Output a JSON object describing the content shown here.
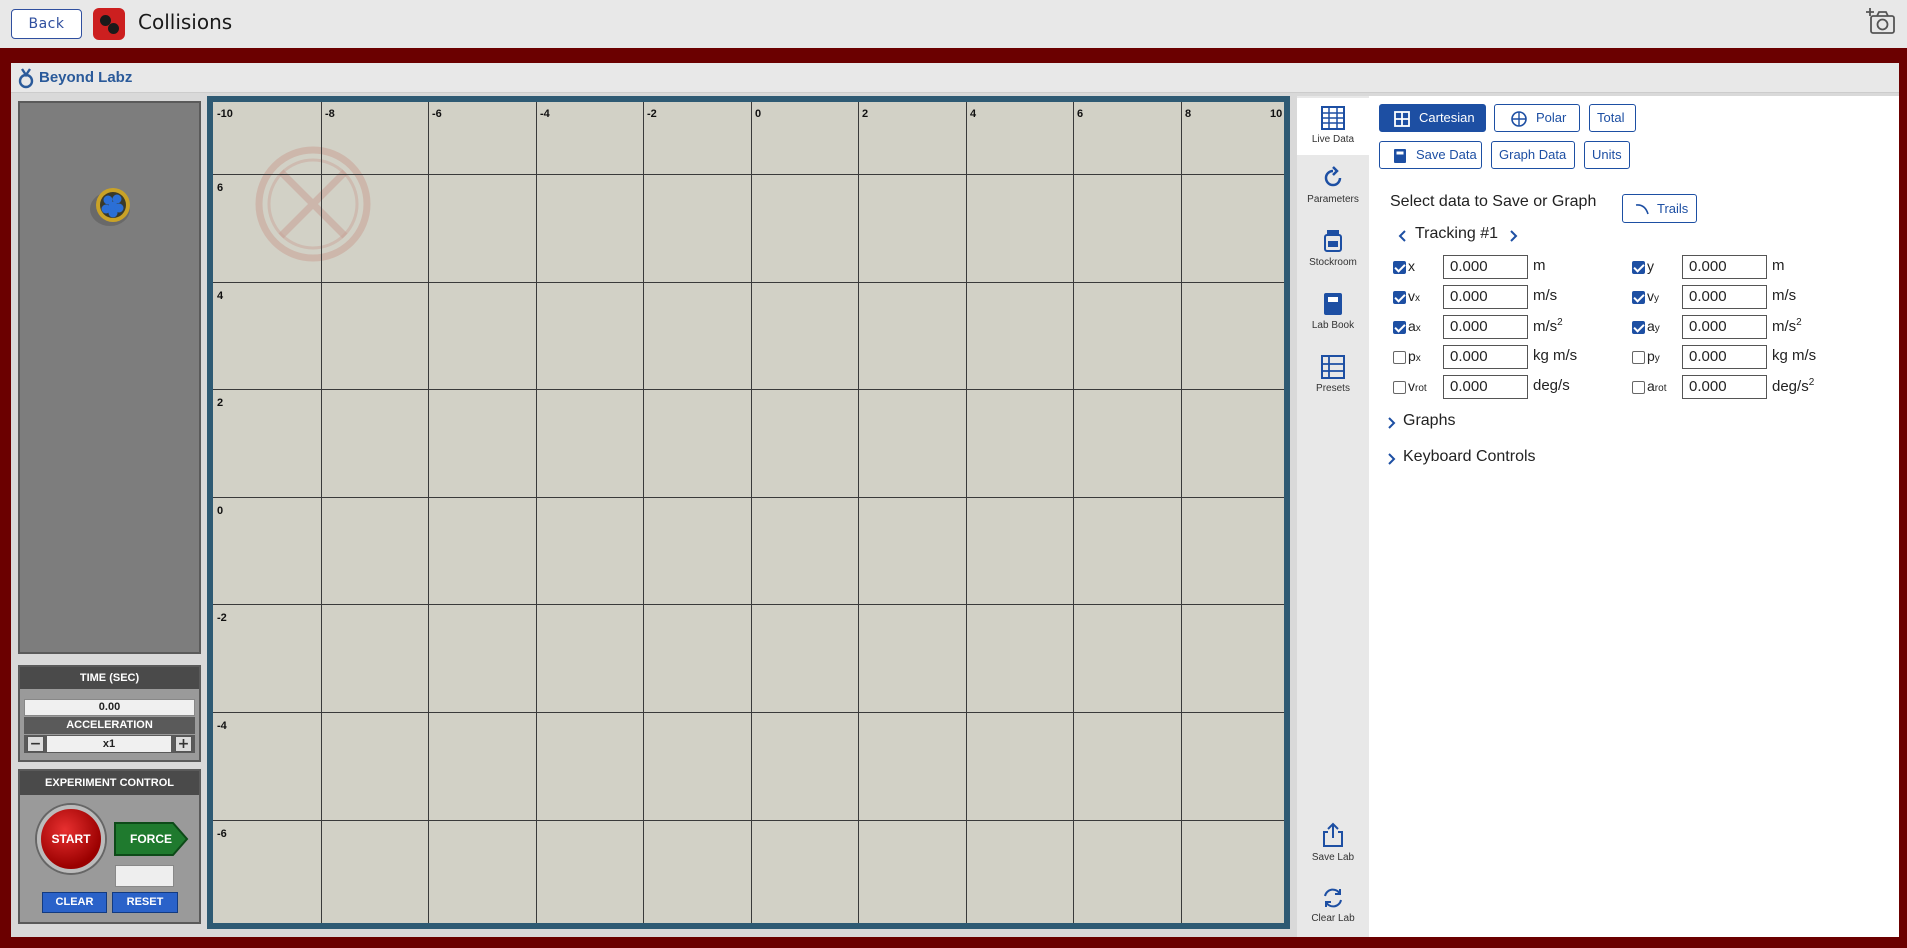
{
  "topbar": {
    "back_label": "Back",
    "title": "Collisions"
  },
  "brand": {
    "name": "Beyond Labz"
  },
  "time": {
    "header": "TIME (SEC)",
    "value": "0.00",
    "accel_label": "ACCELERATION",
    "accel_value": "x1",
    "minus": "−",
    "plus": "+"
  },
  "experiment": {
    "header": "EXPERIMENT CONTROL",
    "start": "START",
    "force": "FORCE",
    "clear": "CLEAR",
    "reset": "RESET"
  },
  "grid": {
    "x_ticks": [
      "-10",
      "-8",
      "-6",
      "-4",
      "-2",
      "0",
      "2",
      "4",
      "6",
      "8",
      "10"
    ],
    "y_ticks": [
      "6",
      "4",
      "2",
      "0",
      "-2",
      "-4",
      "-6"
    ]
  },
  "sidebar": {
    "live_data": "Live Data",
    "parameters": "Parameters",
    "stockroom": "Stockroom",
    "lab_book": "Lab Book",
    "presets": "Presets",
    "save_lab": "Save Lab",
    "clear_lab": "Clear Lab"
  },
  "panel": {
    "cartesian": "Cartesian",
    "polar": "Polar",
    "total": "Total",
    "save_data": "Save Data",
    "graph_data": "Graph Data",
    "units": "Units",
    "select_text": "Select data to Save or Graph",
    "trails": "Trails",
    "tracking": "Tracking #1",
    "graphs": "Graphs",
    "keyboard": "Keyboard Controls",
    "rows": [
      {
        "l_label": "x",
        "l_sub": "",
        "l_checked": true,
        "l_value": "0.000",
        "l_unit": "m",
        "r_label": "y",
        "r_sub": "",
        "r_checked": true,
        "r_value": "0.000",
        "r_unit": "m"
      },
      {
        "l_label": "v",
        "l_sub": "x",
        "l_checked": true,
        "l_value": "0.000",
        "l_unit": "m/s",
        "r_label": "v",
        "r_sub": "y",
        "r_checked": true,
        "r_value": "0.000",
        "r_unit": "m/s"
      },
      {
        "l_label": "a",
        "l_sub": "x",
        "l_checked": true,
        "l_value": "0.000",
        "l_unit": "m/s",
        "r_label": "a",
        "r_sub": "y",
        "r_checked": true,
        "r_value": "0.000",
        "r_unit": "m/s"
      },
      {
        "l_label": "p",
        "l_sub": "x",
        "l_checked": false,
        "l_value": "0.000",
        "l_unit": "kg m/s",
        "r_label": "p",
        "r_sub": "y",
        "r_checked": false,
        "r_value": "0.000",
        "r_unit": "kg m/s"
      },
      {
        "l_label": "v",
        "l_sub": "rot",
        "l_checked": false,
        "l_value": "0.000",
        "l_unit": "deg/s",
        "r_label": "a",
        "r_sub": "rot",
        "r_checked": false,
        "r_value": "0.000",
        "r_unit": "deg/s"
      }
    ],
    "sup2": "2"
  },
  "colors": {
    "accent": "#1d4fa3",
    "frame": "#6b0000",
    "grid_bg": "#d2d1c6",
    "grid_border": "#2e5a73"
  }
}
